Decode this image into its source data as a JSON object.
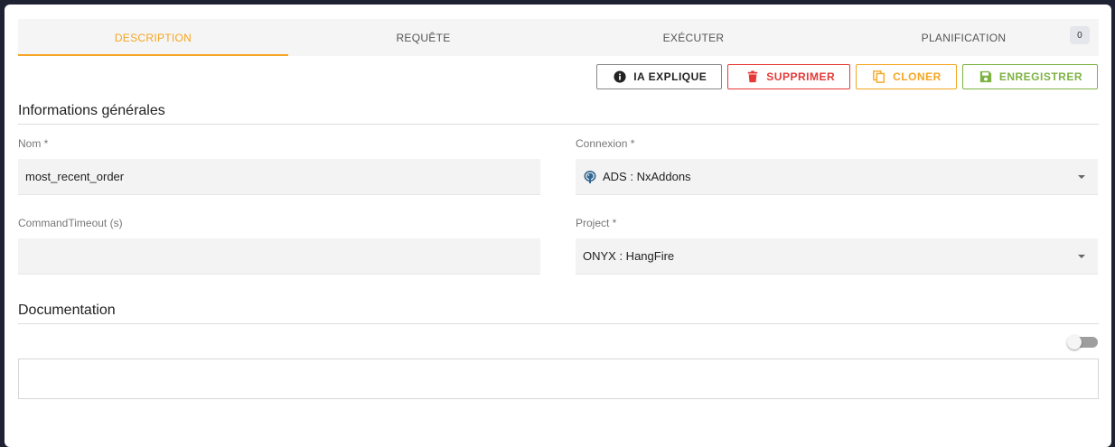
{
  "tabs": [
    {
      "label": "DESCRIPTION",
      "active": true
    },
    {
      "label": "REQUÊTE",
      "active": false
    },
    {
      "label": "EXÉCUTER",
      "active": false
    },
    {
      "label": "PLANIFICATION",
      "active": false,
      "badge": "0"
    }
  ],
  "actions": {
    "ia_label": "IA EXPLIQUE",
    "delete_label": "SUPPRIMER",
    "clone_label": "CLONER",
    "save_label": "ENREGISTRER"
  },
  "general": {
    "title": "Informations générales",
    "name_label": "Nom *",
    "name_value": "most_recent_order",
    "connexion_label": "Connexion *",
    "connexion_value": "ADS : NxAddons",
    "connexion_icon": "postgresql-elephant-icon",
    "timeout_label": "CommandTimeout (s)",
    "timeout_value": "",
    "project_label": "Project *",
    "project_value": "ONYX : HangFire"
  },
  "documentation": {
    "title": "Documentation",
    "toggle_on": false,
    "content": ""
  },
  "colors": {
    "accent": "#f5a623",
    "danger": "#e53935",
    "success": "#7cb342",
    "background": "#1f2233"
  }
}
